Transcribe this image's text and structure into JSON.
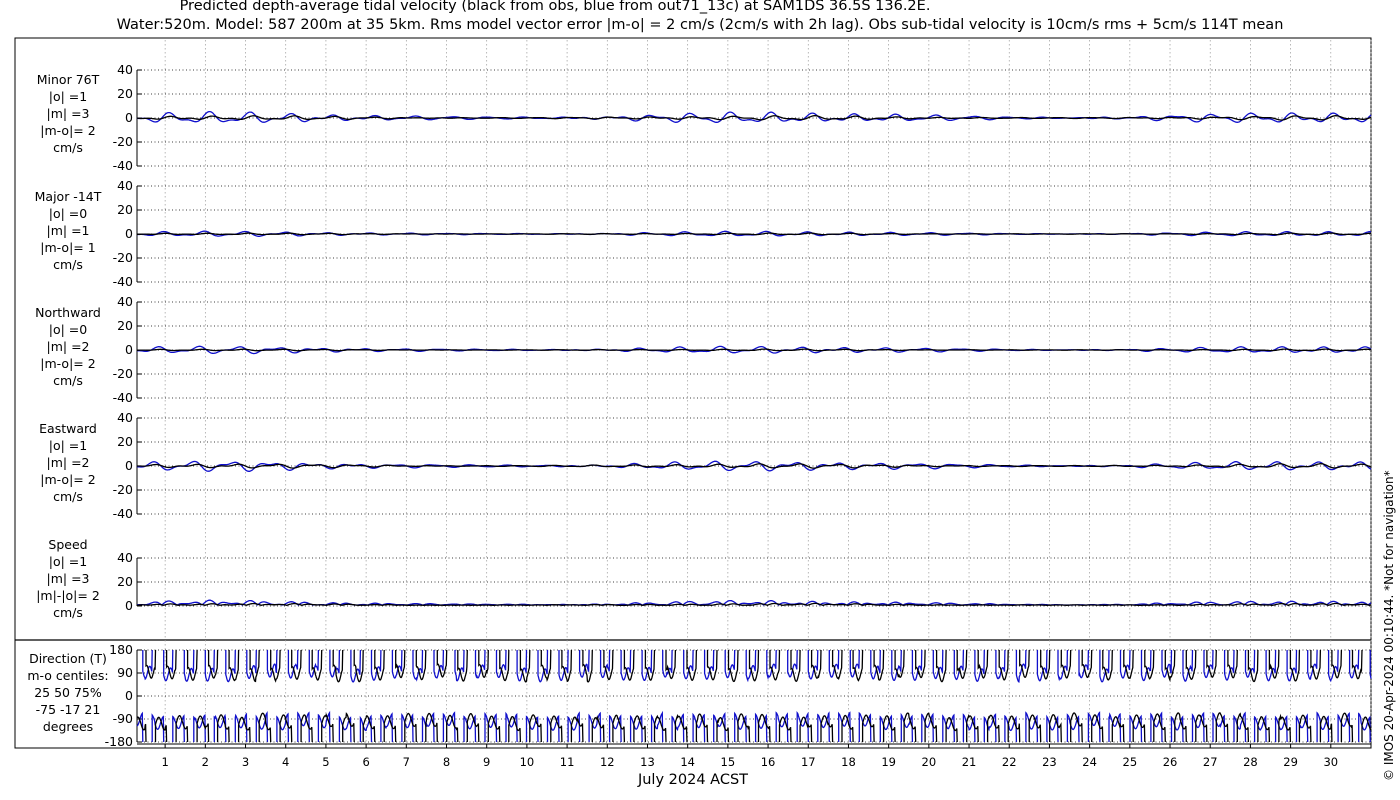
{
  "header": {
    "line1": "Predicted depth-average tidal velocity (black from obs, blue from out71_13c) at SAM1DS 36.5S 136.2E.",
    "line2": "Water:520m. Model: 587 200m at 35 5km. Rms model vector error |m-o| = 2 cm/s (2cm/s with 2h lag). Obs sub-tidal velocity is 10cm/s rms + 5cm/s 114T mean"
  },
  "side_note": "© IMOS 20-Apr-2024 00:10:44. *Not for navigation*",
  "colors": {
    "obs": "#000000",
    "model": "#1010cc",
    "grid": "#9a9a9a"
  },
  "chart_data": {
    "type": "line",
    "xlabel": "July 2024 ACST",
    "xlim": [
      0.3,
      31.0
    ],
    "xticks": [
      "1",
      "2",
      "3",
      "4",
      "5",
      "6",
      "7",
      "8",
      "9",
      "10",
      "11",
      "12",
      "13",
      "14",
      "15",
      "16",
      "17",
      "18",
      "19",
      "20",
      "21",
      "22",
      "23",
      "24",
      "25",
      "26",
      "27",
      "28",
      "29",
      "30"
    ],
    "series_legend": {
      "obs": "black from obs",
      "model": "blue from out71_13c"
    },
    "panels": [
      {
        "id": "minor",
        "label": [
          "Minor 76T",
          "|o| =1",
          "|m| =3",
          "|m-o|= 2",
          "cm/s"
        ],
        "ylim": [
          -40,
          40
        ],
        "yticks": [
          "40",
          "20",
          "0",
          "-20",
          "-40"
        ],
        "obs_amp": 1.5,
        "model_amp": 4.0
      },
      {
        "id": "major",
        "label": [
          "Major -14T",
          "|o| =0",
          "|m| =1",
          "|m-o|= 1",
          "cm/s"
        ],
        "ylim": [
          -40,
          40
        ],
        "yticks": [
          "40",
          "20",
          "0",
          "-20",
          "-40"
        ],
        "obs_amp": 0.6,
        "model_amp": 1.8
      },
      {
        "id": "northward",
        "label": [
          "Northward",
          "|o| =0",
          "|m| =2",
          "|m-o|= 2",
          "cm/s"
        ],
        "ylim": [
          -40,
          40
        ],
        "yticks": [
          "40",
          "20",
          "0",
          "-20",
          "-40"
        ],
        "obs_amp": 0.6,
        "model_amp": 2.5
      },
      {
        "id": "eastward",
        "label": [
          "Eastward",
          "|o| =1",
          "|m| =2",
          "|m-o|= 2",
          "cm/s"
        ],
        "ylim": [
          -40,
          40
        ],
        "yticks": [
          "40",
          "20",
          "0",
          "-20",
          "-40"
        ],
        "obs_amp": 1.5,
        "model_amp": 3.5
      },
      {
        "id": "speed",
        "label": [
          "Speed",
          "|o| =1",
          "|m| =3",
          "|m|-|o|= 2",
          "cm/s"
        ],
        "ylim": [
          0,
          40
        ],
        "yticks": [
          "40",
          "20",
          "0"
        ],
        "obs_amp": 1.2,
        "model_amp": 3.0
      },
      {
        "id": "direction",
        "label": [
          "Direction (T)",
          "m-o centiles:",
          "25  50  75%",
          "-75 -17  21",
          "degrees"
        ],
        "ylim": [
          -180,
          180
        ],
        "yticks": [
          "180",
          "90",
          "0",
          "-90",
          "-180"
        ]
      }
    ]
  }
}
